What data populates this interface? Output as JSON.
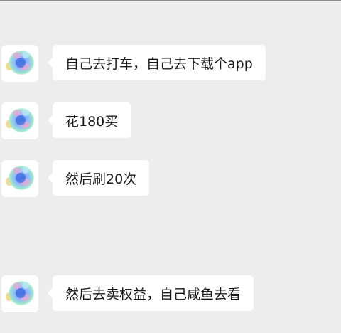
{
  "messages": [
    {
      "text": "自己去打车，自己去下载个app",
      "avatar_icon": "gradient-creature-avatar"
    },
    {
      "text": "花180买",
      "avatar_icon": "gradient-creature-avatar"
    },
    {
      "text": "然后刷20次",
      "avatar_icon": "gradient-creature-avatar"
    },
    {
      "text": "然后去卖权益，自己咸鱼去看",
      "avatar_icon": "gradient-creature-avatar"
    }
  ],
  "colors": {
    "background": "#ededed",
    "bubble": "#ffffff",
    "text": "#191919"
  }
}
